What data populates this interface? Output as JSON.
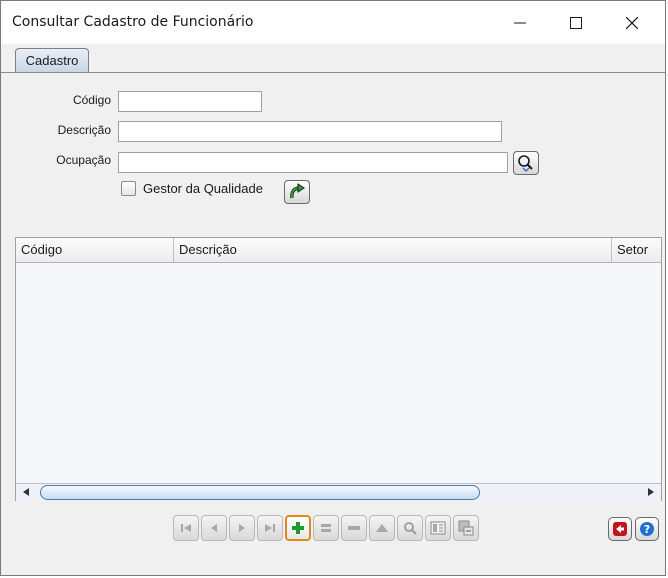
{
  "window": {
    "title": "Consultar Cadastro de Funcionário"
  },
  "tabs": [
    {
      "label": "Cadastro",
      "active": true
    }
  ],
  "form": {
    "codigo": {
      "label": "Código",
      "value": ""
    },
    "descricao": {
      "label": "Descrição",
      "value": ""
    },
    "ocupacao": {
      "label": "Ocupação",
      "value": ""
    },
    "gestor": {
      "label": "Gestor da Qualidade",
      "checked": false
    }
  },
  "grid": {
    "columns": [
      "Código",
      "Descrição",
      "Setor"
    ],
    "rows": []
  },
  "toolbar": {
    "buttons": [
      "first-icon",
      "prev-icon",
      "next-icon",
      "last-icon",
      "insert-icon",
      "edit-icon",
      "delete-icon",
      "post-icon",
      "search-icon",
      "report-icon",
      "export-icon"
    ]
  },
  "colors": {
    "accent": "#e08a1e",
    "tab": "#c9d6e8",
    "insert": "#1f9a2a",
    "exit": "#c0161b",
    "help": "#1f6fd1"
  }
}
